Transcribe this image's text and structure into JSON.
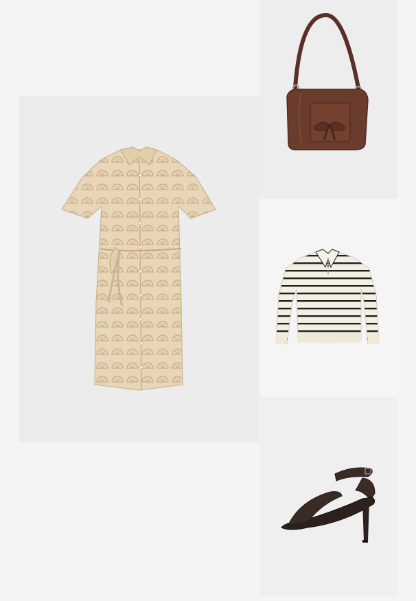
{
  "collage": {
    "background": "#f4f4f4",
    "items": [
      {
        "icon": "shirt-dress-image",
        "colors": {
          "base": "#e8d6b8",
          "pattern": "#c9ac86",
          "shadow": "#d2bd99"
        }
      },
      {
        "icon": "shoulder-bag-image",
        "colors": {
          "leather": "#6b3b2e",
          "dark": "#4f2920",
          "highlight": "#8a5140"
        }
      },
      {
        "icon": "striped-polo-sweater-image",
        "colors": {
          "base": "#f3efe2",
          "stripe": "#1f1f1f"
        }
      },
      {
        "icon": "heeled-sandal-image",
        "colors": {
          "strap": "#3a2b26",
          "sole": "#2c211d"
        }
      }
    ]
  }
}
